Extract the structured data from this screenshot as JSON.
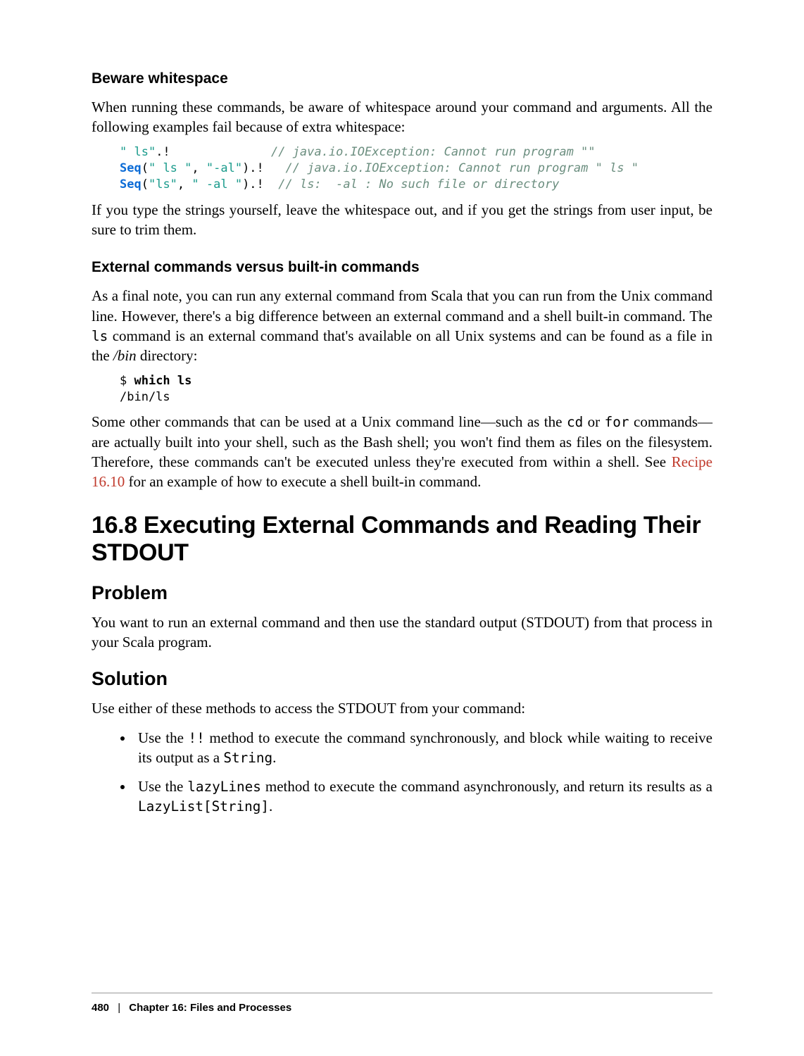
{
  "subsection1": {
    "title": "Beware whitespace",
    "para1": "When running these commands, be aware of whitespace around your command and arguments. All the following examples fail because of extra whitespace:",
    "code": {
      "l1_str": "\" ls\"",
      "l1_rest": ".!              ",
      "l1_comment": "// java.io.IOException: Cannot run program \"\"",
      "l2_key": "Seq",
      "l2_paren1": "(",
      "l2_str1": "\" ls \"",
      "l2_comma": ", ",
      "l2_str2": "\"-al\"",
      "l2_rest": ").!   ",
      "l2_comment": "// java.io.IOException: Cannot run program \" ls \"",
      "l3_key": "Seq",
      "l3_paren1": "(",
      "l3_str1": "\"ls\"",
      "l3_comma": ", ",
      "l3_str2": "\" -al \"",
      "l3_rest": ").!  ",
      "l3_comment": "// ls:  -al : No such file or directory"
    },
    "para2": "If you type the strings yourself, leave the whitespace out, and if you get the strings from user input, be sure to trim them."
  },
  "subsection2": {
    "title": "External commands versus built-in commands",
    "para1_a": "As a final note, you can run any external command from Scala that you can run from the Unix command line. However, there's a big difference between an external command and a shell built-in command. The ",
    "para1_code": "ls",
    "para1_b": " command is an external command that's available on all Unix systems and can be found as a file in the ",
    "para1_italic": "/bin",
    "para1_c": " directory:",
    "code": {
      "prompt": "$ ",
      "cmd": "which ls",
      "out": "/bin/ls"
    },
    "para2_a": "Some other commands that can be used at a Unix command line—such as the ",
    "para2_code1": "cd",
    "para2_b": " or ",
    "para2_code2": "for",
    "para2_c": " commands—are actually built into your shell, such as the Bash shell; you won't find them as files on the filesystem. Therefore, these commands can't be executed unless they're executed from within a shell. See ",
    "para2_link": "Recipe 16.10",
    "para2_d": " for an example of how to execute a shell built-in command."
  },
  "section": {
    "title": "16.8 Executing External Commands and Reading Their STDOUT",
    "problem_heading": "Problem",
    "problem_text": "You want to run an external command and then use the standard output (STDOUT) from that process in your Scala program.",
    "solution_heading": "Solution",
    "solution_intro": "Use either of these methods to access the STDOUT from your command:",
    "bullets": {
      "b1_a": "Use the ",
      "b1_code": "!!",
      "b1_b": " method to execute the command synchronously, and block while waiting to receive its output as a ",
      "b1_code2": "String",
      "b1_c": ".",
      "b2_a": "Use the ",
      "b2_code": "lazyLines",
      "b2_b": " method to execute the command asynchronously, and return its results as a ",
      "b2_code2": "LazyList[String]",
      "b2_c": "."
    }
  },
  "footer": {
    "page": "480",
    "sep": "|",
    "chapter": "Chapter 16: Files and Processes"
  }
}
